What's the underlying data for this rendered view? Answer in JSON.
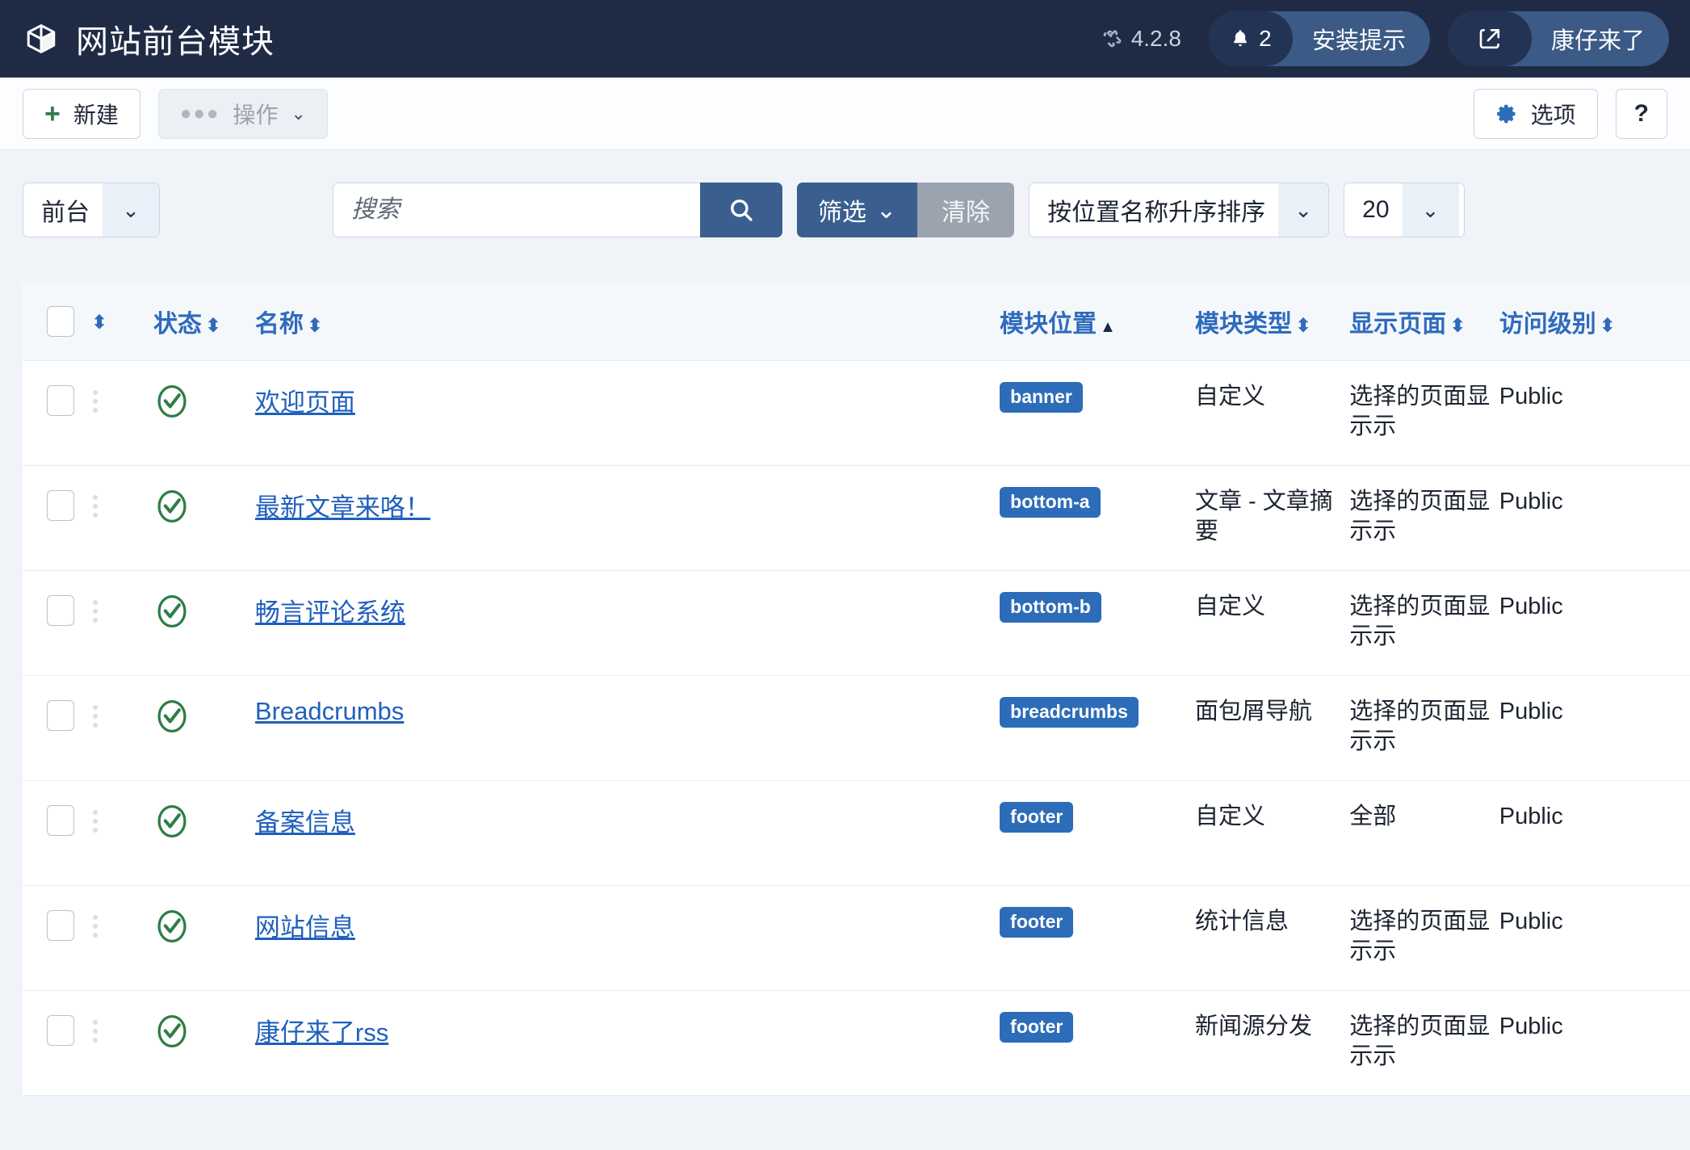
{
  "header": {
    "title": "网站前台模块",
    "logo_icon": "cube-icon",
    "version_label": "4.2.8",
    "version_icon": "joomla-icon",
    "notifications": {
      "icon": "bell-icon",
      "count": "2",
      "label": "安装提示"
    },
    "site_link": {
      "icon": "external-link-icon",
      "label": "康仔来了"
    }
  },
  "toolbar": {
    "new_label": "新建",
    "new_icon": "plus-icon",
    "actions_label": "操作",
    "actions_icon": "ellipsis-icon",
    "actions_caret": "chevron-down-icon",
    "options_label": "选项",
    "options_icon": "gear-icon",
    "help_label": "?",
    "help_icon": "question-mark-icon"
  },
  "filterbar": {
    "client_select": "前台",
    "client_caret": "chevron-down-icon",
    "search_placeholder": "搜索",
    "search_value": "",
    "search_icon": "search-icon",
    "filter_label": "筛选",
    "filter_caret": "chevron-down-icon",
    "clear_label": "清除",
    "sort_select": "按位置名称升序排序",
    "sort_caret": "chevron-down-icon",
    "limit_select": "20"
  },
  "table": {
    "columns": [
      {
        "key": "check",
        "label": "",
        "icon": "checkbox-icon",
        "sort": ""
      },
      {
        "key": "drag",
        "label": "",
        "icon": "sort-icon",
        "sort": "both"
      },
      {
        "key": "status",
        "label": "状态",
        "sort": "both"
      },
      {
        "key": "name",
        "label": "名称",
        "sort": "both"
      },
      {
        "key": "position",
        "label": "模块位置",
        "sort": "asc"
      },
      {
        "key": "type",
        "label": "模块类型",
        "sort": "both"
      },
      {
        "key": "pages",
        "label": "显示页面",
        "sort": "both"
      },
      {
        "key": "access",
        "label": "访问级别",
        "sort": "both"
      }
    ],
    "sort_glyphs": {
      "both": "⬍",
      "asc": "▲"
    },
    "rows": [
      {
        "status": "published",
        "status_icon": "check-circle-icon",
        "name": "欢迎页面",
        "position": "banner",
        "type": "自定义",
        "pages": "选择的页面显示示",
        "access": "Public"
      },
      {
        "status": "published",
        "status_icon": "check-circle-icon",
        "name": "最新文章来咯！",
        "position": "bottom-a",
        "type": "文章 - 文章摘要",
        "pages": "选择的页面显示示",
        "access": "Public"
      },
      {
        "status": "published",
        "status_icon": "check-circle-icon",
        "name": "畅言评论系统",
        "position": "bottom-b",
        "type": "自定义",
        "pages": "选择的页面显示示",
        "access": "Public"
      },
      {
        "status": "published",
        "status_icon": "check-circle-icon",
        "name": "Breadcrumbs",
        "position": "breadcrumbs",
        "type": "面包屑导航",
        "pages": "选择的页面显示示",
        "access": "Public"
      },
      {
        "status": "published",
        "status_icon": "check-circle-icon",
        "name": "备案信息",
        "position": "footer",
        "type": "自定义",
        "pages": "全部",
        "access": "Public"
      },
      {
        "status": "published",
        "status_icon": "check-circle-icon",
        "name": "网站信息",
        "position": "footer",
        "type": "统计信息",
        "pages": "选择的页面显示示",
        "access": "Public"
      },
      {
        "status": "published",
        "status_icon": "check-circle-icon",
        "name": "康仔来了rss",
        "position": "footer",
        "type": "新闻源分发",
        "pages": "选择的页面显示示",
        "access": "Public"
      }
    ]
  },
  "colors": {
    "topbar_bg": "#1f2b45",
    "accent_blue": "#2d6cb8",
    "link_blue": "#1f5fbd",
    "header_link": "#2f6bbd",
    "status_green": "#2e7d46",
    "button_primary": "#3a5f8f",
    "button_muted": "#9aa3ae",
    "page_bg": "#f0f4f9"
  }
}
